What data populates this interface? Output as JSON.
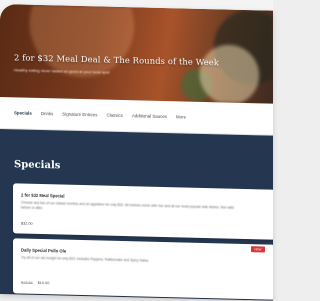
{
  "hero": {
    "title": "2 for $32 Meal Deal & The Rounds of the Week",
    "subtitle": "Healthy eating never tasted so good at your local spot"
  },
  "tabs": [
    "Specials",
    "Drinks",
    "Signature Entrees",
    "Classics",
    "Additional Sauces",
    "More"
  ],
  "specials": {
    "heading": "Specials",
    "items": [
      {
        "title": "2 for $32 Meal Special",
        "description": "Choose any two of our classic burritos and an appetizer for only $32. All entrees come with rice and all our most popular side dishes. Not valid before or after.",
        "price": "$32.00"
      },
      {
        "title": "Daily Special Pollo Ole",
        "description": "Try all of our ole tonight for only $10, includes Peppers, Rattlesnake and Spicy Salsa.",
        "old_price": "$13.99",
        "price": "$10.00",
        "badge": "NEW"
      }
    ]
  },
  "colors": {
    "content_bg": "#243650",
    "badge_bg": "#d43a3a",
    "hero_bg": "#7a3a1e"
  }
}
